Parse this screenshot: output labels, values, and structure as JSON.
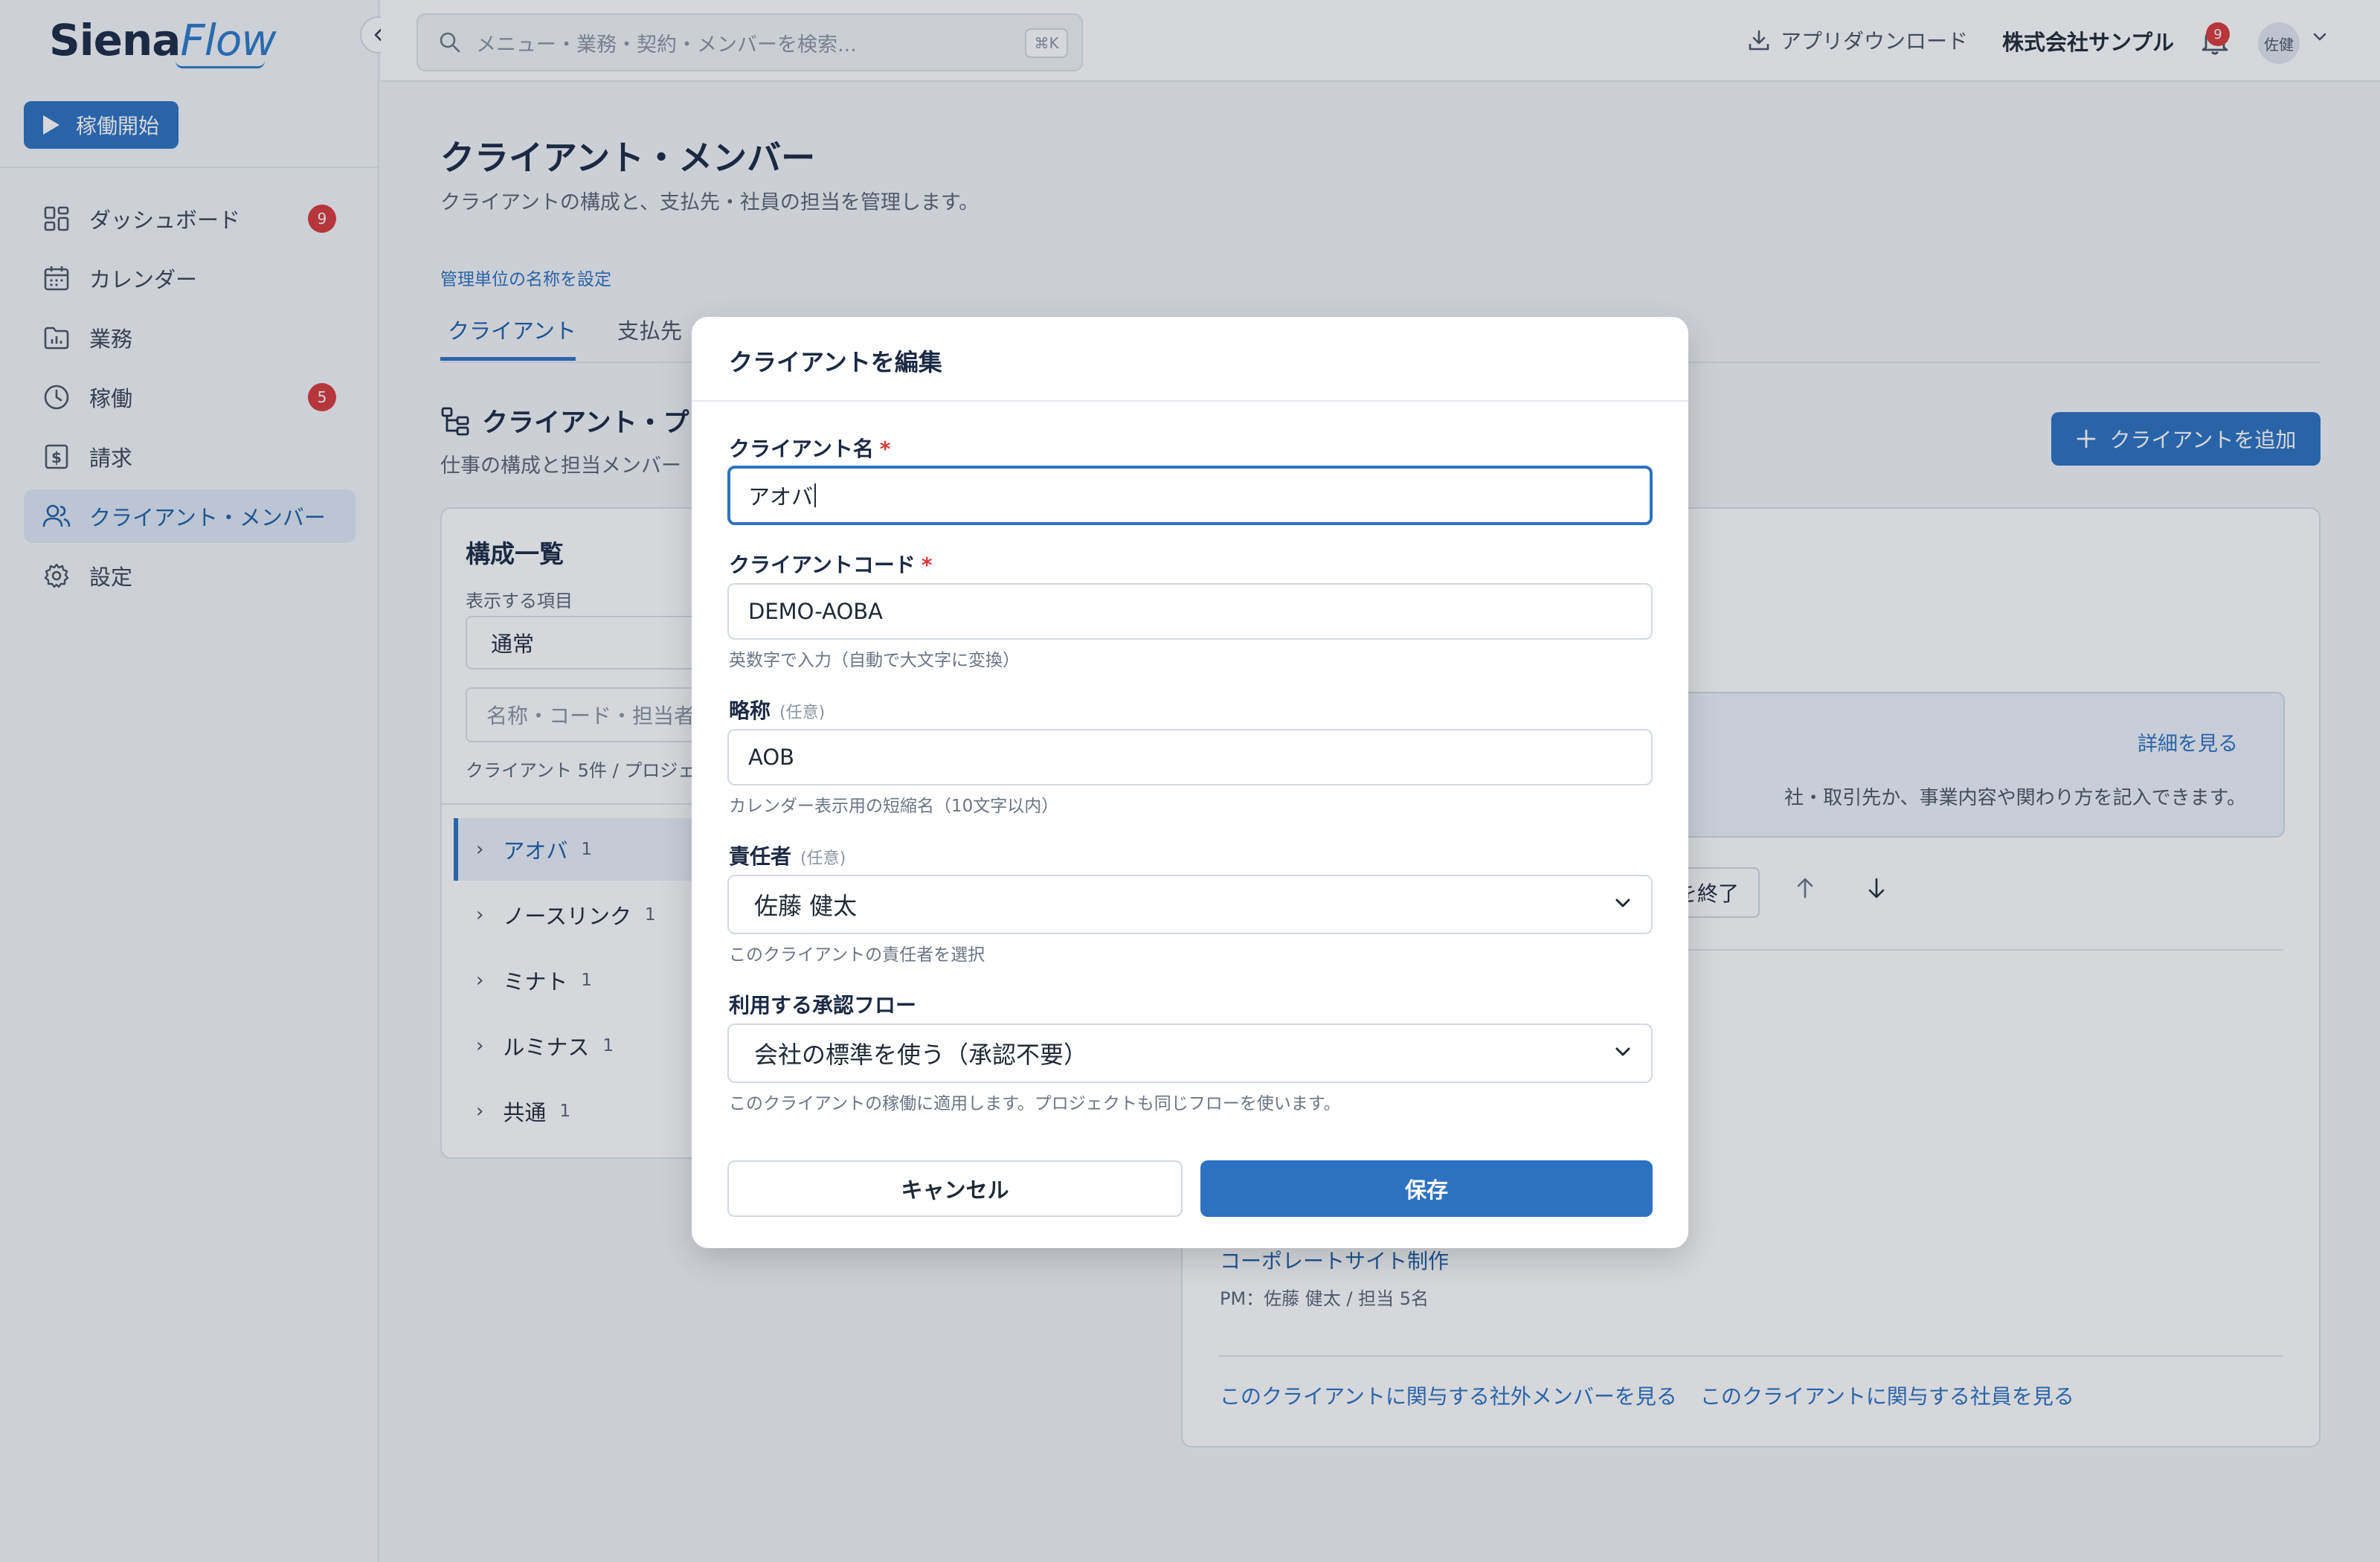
{
  "app": {
    "logo_part1": "Siena",
    "logo_part2": "Flow"
  },
  "sidebar": {
    "start_button": "稼働開始",
    "items": [
      {
        "label": "ダッシュボード",
        "badge": "9"
      },
      {
        "label": "カレンダー"
      },
      {
        "label": "業務"
      },
      {
        "label": "稼働",
        "badge": "5"
      },
      {
        "label": "請求"
      },
      {
        "label": "クライアント・メンバー"
      },
      {
        "label": "設定"
      }
    ]
  },
  "topbar": {
    "search_placeholder": "メニュー・業務・契約・メンバーを検索...",
    "shortcut": "⌘K",
    "download_label": "アプリダウンロード",
    "company": "株式会社サンプル",
    "notification_count": "9",
    "user_initials": "佐健"
  },
  "page": {
    "title": "クライアント・メンバー",
    "subtitle": "クライアントの構成と、支払先・社員の担当を管理します。",
    "unit_link": "管理単位の名称を設定",
    "tabs": [
      "クライアント",
      "支払先"
    ],
    "section_title": "クライアント・プ",
    "section_subtitle": "仕事の構成と担当メンバー",
    "add_button": "クライアントを追加"
  },
  "left_panel": {
    "title": "構成一覧",
    "display_label": "表示する項目",
    "display_value": "通常",
    "search_placeholder": "名称・コード・担当者",
    "count_text": "クライアント 5件 / プロジェ",
    "tree": [
      {
        "label": "アオバ",
        "count": "1"
      },
      {
        "label": "ノースリンク",
        "count": "1"
      },
      {
        "label": "ミナト",
        "count": "1"
      },
      {
        "label": "ルミナス",
        "count": "1"
      },
      {
        "label": "共通",
        "count": "1"
      }
    ]
  },
  "right_panel": {
    "detail_link": "詳細を見る",
    "description_fragment": "社・取引先か、事業内容や関わり方を記入できます。",
    "end_button_fragment": "を終了",
    "project_name": "コーポレートサイト制作",
    "project_meta": "PM：佐藤 健太 / 担当 5名",
    "link_external": "このクライアントに関与する社外メンバーを見る",
    "link_employees": "このクライアントに関与する社員を見る"
  },
  "modal": {
    "title": "クライアントを編集",
    "name_label": "クライアント名",
    "name_value": "アオバ",
    "code_label": "クライアントコード",
    "code_value": "DEMO-AOBA",
    "code_help": "英数字で入力（自動で大文字に変換）",
    "short_label": "略称",
    "optional": "(任意)",
    "short_value": "AOB",
    "short_help": "カレンダー表示用の短縮名（10文字以内）",
    "owner_label": "責任者",
    "owner_value": "佐藤 健太",
    "owner_help": "このクライアントの責任者を選択",
    "flow_label": "利用する承認フロー",
    "flow_value": "会社の標準を使う（承認不要）",
    "flow_help": "このクライアントの稼働に適用します。プロジェクトも同じフローを使います。",
    "required_mark": "*",
    "cancel": "キャンセル",
    "save": "保存"
  },
  "colors": {
    "accent": "#2d72c0",
    "badge": "#d93a3a",
    "required": "#d93a3a"
  }
}
